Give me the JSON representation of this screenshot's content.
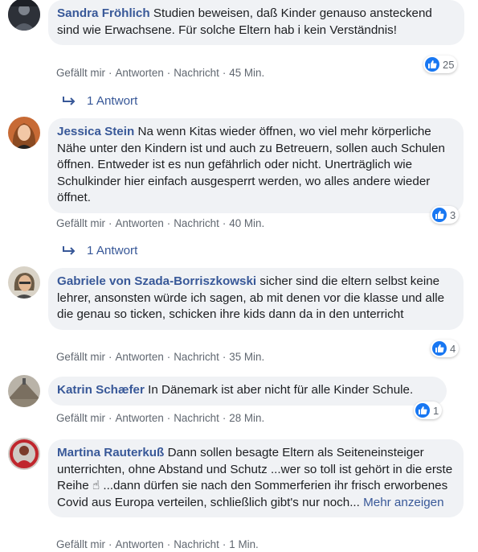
{
  "comments": [
    {
      "author": "Sandra Fröhlich",
      "text": "Studien beweisen, daß Kinder genauso ansteckend sind wie Erwachsene. Für solche Eltern hab i kein Verständnis!",
      "like_label": "Gefällt mir",
      "reply_label": "Antworten",
      "message_label": "Nachricht",
      "time": "45 Min.",
      "reaction_count": "25",
      "replies_label": "1 Antwort"
    },
    {
      "author": "Jessica Stein",
      "text": "Na wenn Kitas wieder öffnen, wo viel mehr körperliche Nähe unter den Kindern ist und auch zu Betreuern, sollen auch Schulen öffnen. Entweder ist es nun gefährlich oder nicht. Unerträglich wie Schulkinder hier einfach ausgesperrt werden, wo alles andere wieder öffnet.",
      "like_label": "Gefällt mir",
      "reply_label": "Antworten",
      "message_label": "Nachricht",
      "time": "40 Min.",
      "reaction_count": "3",
      "replies_label": "1 Antwort"
    },
    {
      "author": "Gabriele von Szada-Borriszkowski",
      "text": "sicher sind die eltern selbst keine lehrer, ansonsten würde ich sagen, ab mit denen vor die klasse und alle die genau so ticken, schicken ihre kids dann da in den unterricht",
      "like_label": "Gefällt mir",
      "reply_label": "Antworten",
      "message_label": "Nachricht",
      "time": "35 Min.",
      "reaction_count": "4"
    },
    {
      "author": "Katrin Schæfer",
      "text": "In Dänemark ist aber nicht für alle Kinder Schule.",
      "like_label": "Gefällt mir",
      "reply_label": "Antworten",
      "message_label": "Nachricht",
      "time": "28 Min.",
      "reaction_count": "1"
    },
    {
      "author": "Martina Rauterkuß",
      "text": "Dann sollen besagte Eltern als Seiteneinsteiger unterrichten, ohne Abstand und Schutz ...wer so toll ist gehört in die erste Reihe ☝ ...dann dürfen sie nach den Sommerferien ihr frisch erworbenes Covid aus Europa verteilen, schließlich gibt's nur noch...",
      "more_label": "Mehr anzeigen",
      "like_label": "Gefällt mir",
      "reply_label": "Antworten",
      "message_label": "Nachricht",
      "time": "1 Min."
    }
  ],
  "icons": {
    "like": "like-icon",
    "reply_arrow": "reply-arrow-icon"
  },
  "colors": {
    "author": "#385898",
    "bubble": "#f0f2f5",
    "like_blue": "#1877f2",
    "meta": "#606770"
  }
}
